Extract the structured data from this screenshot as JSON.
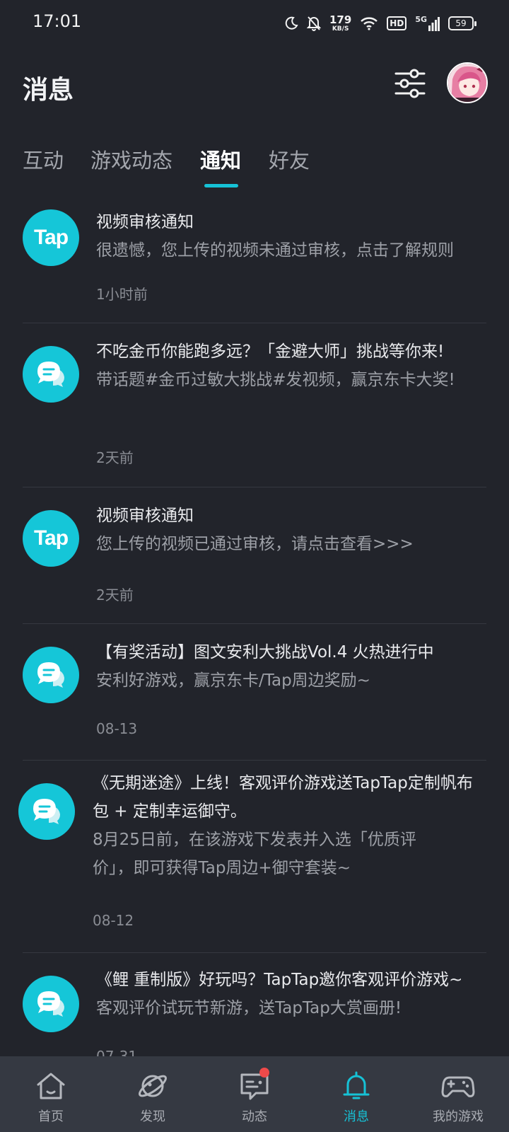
{
  "status_bar": {
    "time": "17:01",
    "speed_value": "179",
    "speed_unit": "KB/S",
    "hd": "HD",
    "network": "5G",
    "battery": "59"
  },
  "header": {
    "title": "消息"
  },
  "tabs": [
    {
      "label": "互动",
      "active": false
    },
    {
      "label": "游戏动态",
      "active": false
    },
    {
      "label": "通知",
      "active": true
    },
    {
      "label": "好友",
      "active": false
    }
  ],
  "notifications": [
    {
      "icon": "tap-logo-icon",
      "icon_text": "Tap",
      "title": "视频审核通知",
      "body": "很遗憾，您上传的视频未通过审核，点击了解规则",
      "time": "1小时前"
    },
    {
      "icon": "chat-bubble-icon",
      "title": "不吃金币你能跑多远？「金避大师」挑战等你来!",
      "body": "带话题#金币过敏大挑战#发视频，赢京东卡大奖!",
      "time": "2天前"
    },
    {
      "icon": "tap-logo-icon",
      "icon_text": "Tap",
      "title": "视频审核通知",
      "body": "您上传的视频已通过审核，请点击查看>>>",
      "time": "2天前"
    },
    {
      "icon": "chat-bubble-icon",
      "title": "【有奖活动】图文安利大挑战Vol.4 火热进行中",
      "body": "安利好游戏，赢京东卡/Tap周边奖励~",
      "time": "08-13"
    },
    {
      "icon": "chat-bubble-icon",
      "title": "《无期迷途》上线！客观评价游戏送TapTap定制帆布包 + 定制幸运御守。",
      "body": "8月25日前，在该游戏下发表并入选「优质评价」，即可获得Tap周边+御守套装~",
      "time": "08-12"
    },
    {
      "icon": "chat-bubble-icon",
      "title": "《鲤 重制版》好玩吗？TapTap邀你客观评价游戏~",
      "body": "客观评价试玩节新游，送TapTap大赏画册!",
      "time": "07-31"
    }
  ],
  "bottom_nav": [
    {
      "label": "首页",
      "icon": "home-icon",
      "active": false
    },
    {
      "label": "发现",
      "icon": "planet-icon",
      "active": false
    },
    {
      "label": "动态",
      "icon": "feed-icon",
      "active": false,
      "badge": true
    },
    {
      "label": "消息",
      "icon": "bell-icon",
      "active": true
    },
    {
      "label": "我的游戏",
      "icon": "gamepad-icon",
      "active": false
    }
  ],
  "colors": {
    "background": "#22242b",
    "accent": "#16c2d6",
    "nav_background": "#353942",
    "badge": "#ef4a4a"
  }
}
